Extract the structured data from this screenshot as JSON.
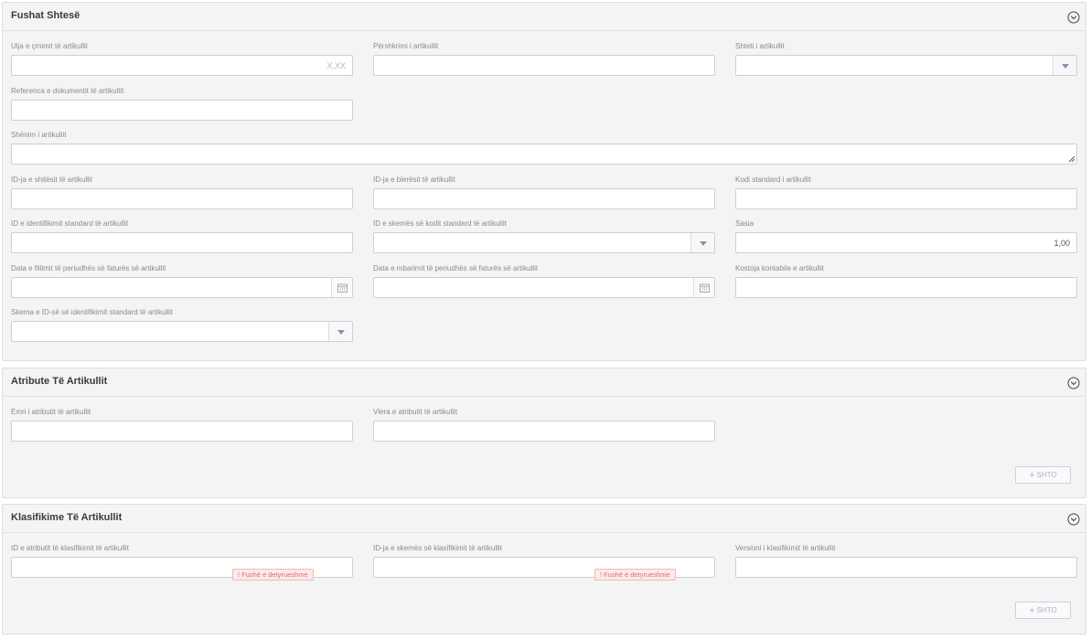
{
  "sections": {
    "additional": {
      "title": "Fushat Shtesë",
      "fields": {
        "price_discount": {
          "label": "Ulja e çmimit të artikullit",
          "placeholder": "X,XX"
        },
        "description": {
          "label": "Përshkrimi i artikullit"
        },
        "country": {
          "label": "Shteti i artikullit"
        },
        "doc_reference": {
          "label": "Referenca e dokumentit të artikullit"
        },
        "note": {
          "label": "Shënim i artikullit"
        },
        "seller_id": {
          "label": "ID-ja e shitësit të artikullit"
        },
        "buyer_id": {
          "label": "ID-ja e blerësit të artikullit"
        },
        "standard_code": {
          "label": "Kodi standard i artikullit"
        },
        "standard_id": {
          "label": "ID e identifikimit standard të artikullit"
        },
        "standard_scheme": {
          "label": "ID e skemës së kodit standard të artikullit"
        },
        "quantity": {
          "label": "Sasia",
          "value": "1,00"
        },
        "period_start": {
          "label": "Data e fillimit të periudhës së faturës së artikullit"
        },
        "period_end": {
          "label": "Data e mbarimit të periudhës së faturës së artikullit"
        },
        "accounting_cost": {
          "label": "Kostoja kontabile e artikullit"
        },
        "id_scheme": {
          "label": "Skema e ID-së së identifikimit standard të artikullit"
        }
      }
    },
    "attributes": {
      "title": "Atribute Të Artikullit",
      "fields": {
        "attr_name": {
          "label": "Emri i atributit të artikullit"
        },
        "attr_value": {
          "label": "Vlera e atributit të artikullit"
        }
      },
      "add_label": "SHTO"
    },
    "classifications": {
      "title": "Klasifikime Të Artikullit",
      "fields": {
        "class_attr_id": {
          "label": "ID e atributit të klasifikimit të artikullit"
        },
        "class_scheme_id": {
          "label": "ID-ja e skemës së klasifikimit të artikullit"
        },
        "class_version": {
          "label": "Versioni i klasifikimit të artikullit"
        }
      },
      "required_badge": "! Fushë e detyrueshme",
      "add_label": "SHTO"
    }
  },
  "icons": {
    "collapse": "chevron-down-circle-icon",
    "dropdown": "caret-down-icon",
    "calendar": "calendar-icon",
    "plus": "plus-icon"
  },
  "colors": {
    "section_bg": "#f4f4f4",
    "required_text": "#e06c6c",
    "add_button_text": "#a9b2d4"
  }
}
